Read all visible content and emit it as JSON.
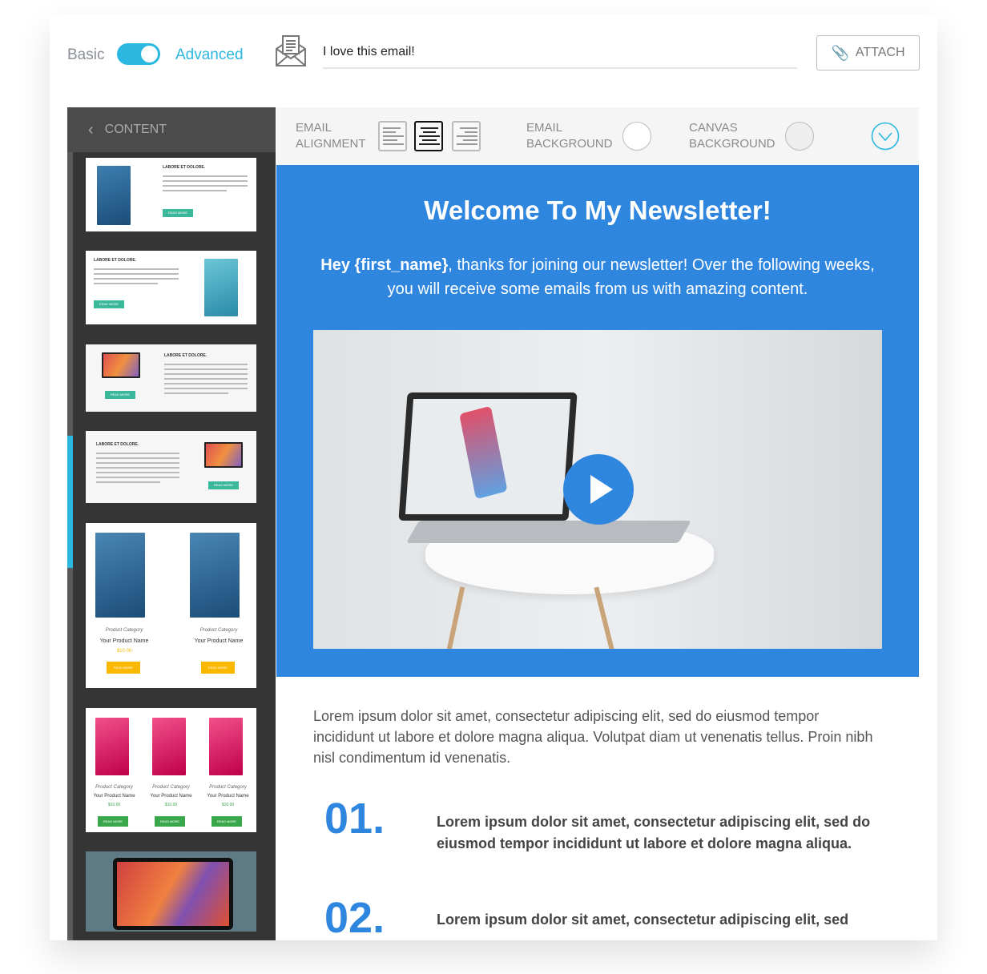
{
  "mode_toggle": {
    "left_label": "Basic",
    "right_label": "Advanced",
    "state": "advanced"
  },
  "subject": {
    "value": "I love this email!"
  },
  "attach": {
    "label": "ATTACH",
    "icon": "paperclip-icon"
  },
  "sidebar": {
    "title": "CONTENT",
    "templates": [
      {
        "title": "LABORE ET DOLORE.",
        "button": "READ MORE"
      },
      {
        "title": "LABORE ET DOLORE.",
        "button": "READ MORE"
      },
      {
        "title": "LABORE ET DOLORE.",
        "button": "READ MORE"
      },
      {
        "title": "LABORE ET DOLORE.",
        "button": "READ MORE"
      },
      {
        "category": "Product Category",
        "name": "Your Product Name",
        "price": "$10.00",
        "button": "READ MORE"
      },
      {
        "category": "Product Category",
        "name": "Your Product Name",
        "price": "$10.00",
        "button": "READ MORE"
      }
    ]
  },
  "toolbar": {
    "alignment_label_1": "EMAIL",
    "alignment_label_2": "ALIGNMENT",
    "alignment_selected": "center",
    "email_bg_1": "EMAIL",
    "email_bg_2": "BACKGROUND",
    "email_bg_color": "#ffffff",
    "canvas_bg_1": "CANVAS",
    "canvas_bg_2": "BACKGROUND",
    "canvas_bg_color": "#eeeeee"
  },
  "email": {
    "accent": "#2f86de",
    "heading": "Welcome To My Newsletter!",
    "greeting": "Hey {first_name}",
    "intro": ", thanks for joining our newsletter! Over the following weeks, you will receive some emails from us with amazing content.",
    "paragraph": "Lorem ipsum dolor sit amet, consectetur adipiscing elit, sed do eiusmod tempor incididunt ut labore et dolore magna aliqua. Volutpat diam ut venenatis tellus. Proin nibh nisl condimentum id venenatis.",
    "items": [
      {
        "num": "01.",
        "text": "Lorem ipsum dolor sit amet, consectetur adipiscing elit, sed do eiusmod tempor incididunt ut labore et dolore magna aliqua."
      },
      {
        "num": "02.",
        "text": "Lorem ipsum dolor sit amet, consectetur adipiscing elit, sed"
      }
    ]
  }
}
